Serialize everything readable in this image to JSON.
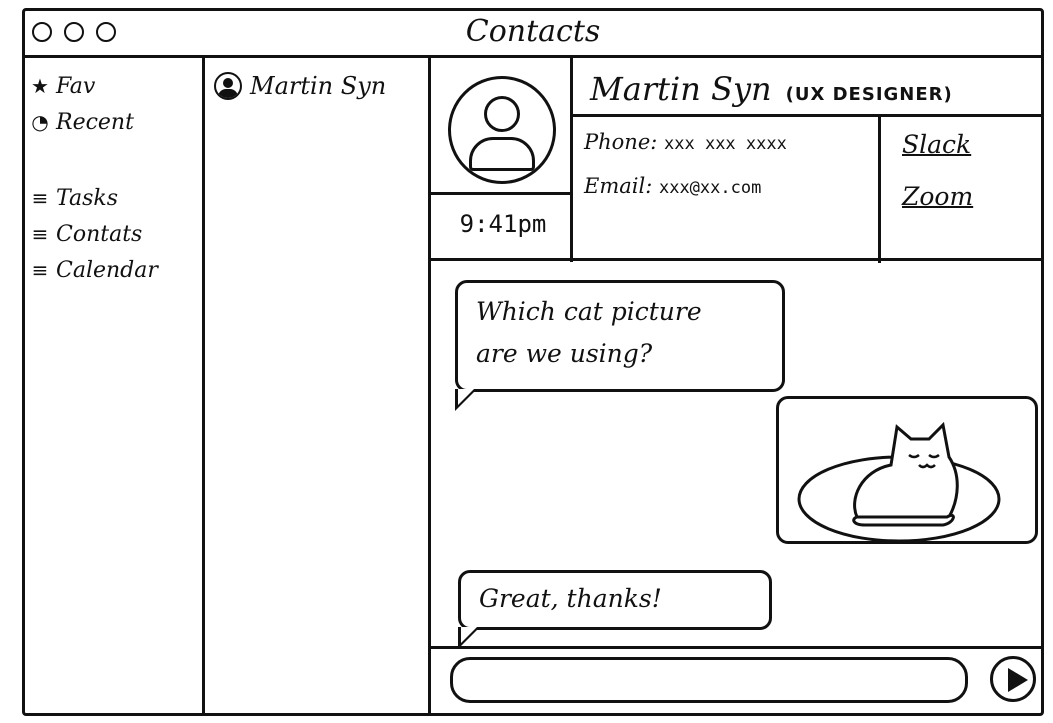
{
  "window": {
    "title": "Contacts",
    "controls": [
      "circle",
      "circle",
      "circle"
    ]
  },
  "sidebar": {
    "items": [
      {
        "label": "Fav",
        "icon": "star-icon"
      },
      {
        "label": "Recent",
        "icon": "clock-icon"
      },
      {
        "label": "Tasks",
        "icon": "menu-icon"
      },
      {
        "label": "Contats",
        "icon": "menu-icon"
      },
      {
        "label": "Calendar",
        "icon": "menu-icon"
      }
    ]
  },
  "contacts": {
    "items": [
      {
        "name": "Martin Syn",
        "icon": "avatar-icon"
      }
    ]
  },
  "profile": {
    "name": "Martin Syn",
    "role": "(UX DESIGNER)",
    "time": "9:41pm",
    "phone_label": "Phone:",
    "phone_value": "xxx xxx xxxx",
    "email_label": "Email:",
    "email_value": "xxx@xx.com",
    "links": [
      "Slack",
      "Zoom"
    ]
  },
  "chat": {
    "messages": [
      {
        "text_line1": "Which cat picture",
        "text_line2": "are we using?"
      },
      {
        "text": "Great, thanks!"
      }
    ],
    "image_icon": "cat-image",
    "composer_placeholder": "",
    "send_icon": "send-icon"
  }
}
